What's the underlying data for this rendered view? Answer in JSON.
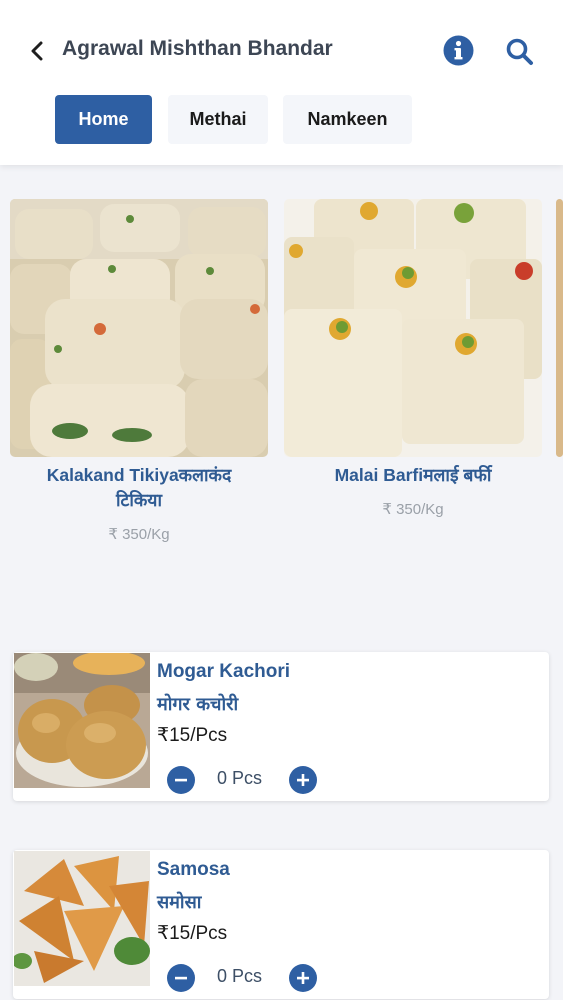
{
  "header": {
    "title": "Agrawal Mishthan Bhandar",
    "back_icon": "chevron-left-icon",
    "info_icon": "info-icon",
    "search_icon": "search-icon",
    "accent_color": "#2e5fa3"
  },
  "tabs": [
    {
      "label": "Home",
      "active": true
    },
    {
      "label": "Methai",
      "active": false
    },
    {
      "label": "Namkeen",
      "active": false
    }
  ],
  "featured": [
    {
      "name": "Kalakand Tikiyaकलाकंद",
      "name_line2": "टिकिया",
      "price": "₹ 350/Kg"
    },
    {
      "name": "Malai Barfiमलाई बर्फी",
      "price": "₹ 350/Kg"
    }
  ],
  "products": [
    {
      "name": "Mogar Kachori",
      "hindi": "मोगर कचोरी",
      "price": "₹15/Pcs",
      "qty": "0 Pcs"
    },
    {
      "name": "Samosa",
      "hindi": "समोसा",
      "price": "₹15/Pcs",
      "qty": "0 Pcs"
    }
  ]
}
